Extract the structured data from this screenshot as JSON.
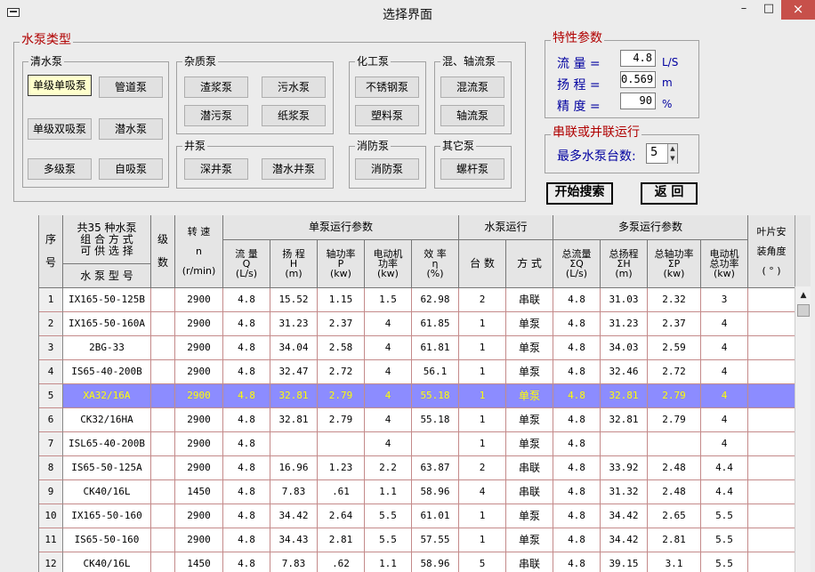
{
  "window": {
    "title": "选择界面",
    "min": "–",
    "max": "□",
    "close": "×"
  },
  "pump_types": {
    "title": "水泵类型",
    "clear_water": {
      "title": "清水泵",
      "buttons": [
        "单级单吸泵",
        "管道泵",
        "单级双吸泵",
        "潜水泵",
        "多级泵",
        "自吸泵"
      ]
    },
    "impurity": {
      "title": "杂质泵",
      "buttons": [
        "渣浆泵",
        "污水泵",
        "潜污泵",
        "纸浆泵"
      ]
    },
    "chemical": {
      "title": "化工泵",
      "buttons": [
        "不锈钢泵",
        "塑料泵"
      ]
    },
    "mixed_flow": {
      "title": "混、轴流泵",
      "buttons": [
        "混流泵",
        "轴流泵"
      ]
    },
    "well": {
      "title": "井泵",
      "buttons": [
        "深井泵",
        "潜水井泵"
      ]
    },
    "fire": {
      "title": "消防泵",
      "buttons": [
        "消防泵"
      ]
    },
    "other": {
      "title": "其它泵",
      "buttons": [
        "螺杆泵"
      ]
    }
  },
  "params": {
    "title": "特性参数",
    "flow_label": "流  量 =",
    "flow_value": "4.8",
    "flow_unit": "L/S",
    "head_label": "扬  程 =",
    "head_value": "0.569",
    "head_unit": "m",
    "precision_label": "精  度 =",
    "precision_value": "90",
    "precision_unit": "%"
  },
  "operation": {
    "title": "串联或并联运行",
    "max_pumps_label": "最多水泵台数:",
    "max_pumps_value": "5"
  },
  "actions": {
    "search": "开始搜索",
    "back": "返  回"
  },
  "grid": {
    "headers": {
      "seq": "序\n\n号",
      "model_top": "共35 种水泵\n组 合 方 式\n可 供 选 择",
      "model_bottom": "水 泵 型 号",
      "stages": "级\n\n数",
      "speed": "转  速\n\nn\n\n(r/min)",
      "single_group": "单泵运行参数",
      "flow": "流  量\nQ\n(L/s)",
      "head": "扬  程\nH\n(m)",
      "shaft_power": "轴功率\nP\n(kw)",
      "motor_power": "电动机\n功率\n(kw)",
      "efficiency": "效  率\nη\n(%)",
      "run_group": "水泵运行",
      "count": "台  数",
      "mode": "方  式",
      "multi_group": "多泵运行参数",
      "total_flow": "总流量\nΣQ\n(L/s)",
      "total_head": "总扬程\nΣH\n(m)",
      "total_shaft": "总轴功率\nΣP\n(kw)",
      "total_motor": "电动机\n总功率\n(kw)",
      "blade_angle": "叶片安\n\n装角度\n\n( ° )"
    },
    "rows": [
      [
        "1",
        "IX165-50-125B",
        "",
        "2900",
        "4.8",
        "15.52",
        "1.15",
        "1.5",
        "62.98",
        "2",
        "串联",
        "4.8",
        "31.03",
        "2.32",
        "3",
        ""
      ],
      [
        "2",
        "IX165-50-160A",
        "",
        "2900",
        "4.8",
        "31.23",
        "2.37",
        "4",
        "61.85",
        "1",
        "单泵",
        "4.8",
        "31.23",
        "2.37",
        "4",
        ""
      ],
      [
        "3",
        "2BG-33",
        "",
        "2900",
        "4.8",
        "34.04",
        "2.58",
        "4",
        "61.81",
        "1",
        "单泵",
        "4.8",
        "34.03",
        "2.59",
        "4",
        ""
      ],
      [
        "4",
        "IS65-40-200B",
        "",
        "2900",
        "4.8",
        "32.47",
        "2.72",
        "4",
        "56.1",
        "1",
        "单泵",
        "4.8",
        "32.46",
        "2.72",
        "4",
        ""
      ],
      [
        "5",
        "XA32/16A",
        "",
        "2900",
        "4.8",
        "32.81",
        "2.79",
        "4",
        "55.18",
        "1",
        "单泵",
        "4.8",
        "32.81",
        "2.79",
        "4",
        ""
      ],
      [
        "6",
        "CK32/16HA",
        "",
        "2900",
        "4.8",
        "32.81",
        "2.79",
        "4",
        "55.18",
        "1",
        "单泵",
        "4.8",
        "32.81",
        "2.79",
        "4",
        ""
      ],
      [
        "7",
        "ISL65-40-200B",
        "",
        "2900",
        "4.8",
        "",
        "",
        "4",
        "",
        "1",
        "单泵",
        "4.8",
        "",
        "",
        "4",
        ""
      ],
      [
        "8",
        "IS65-50-125A",
        "",
        "2900",
        "4.8",
        "16.96",
        "1.23",
        "2.2",
        "63.87",
        "2",
        "串联",
        "4.8",
        "33.92",
        "2.48",
        "4.4",
        ""
      ],
      [
        "9",
        "CK40/16L",
        "",
        "1450",
        "4.8",
        "7.83",
        ".61",
        "1.1",
        "58.96",
        "4",
        "串联",
        "4.8",
        "31.32",
        "2.48",
        "4.4",
        ""
      ],
      [
        "10",
        "IX165-50-160",
        "",
        "2900",
        "4.8",
        "34.42",
        "2.64",
        "5.5",
        "61.01",
        "1",
        "单泵",
        "4.8",
        "34.42",
        "2.65",
        "5.5",
        ""
      ],
      [
        "11",
        "IS65-50-160",
        "",
        "2900",
        "4.8",
        "34.43",
        "2.81",
        "5.5",
        "57.55",
        "1",
        "单泵",
        "4.8",
        "34.42",
        "2.81",
        "5.5",
        ""
      ],
      [
        "12",
        "CK40/16L",
        "",
        "1450",
        "4.8",
        "7.83",
        ".62",
        "1.1",
        "58.96",
        "5",
        "串联",
        "4.8",
        "39.15",
        "3.1",
        "5.5",
        ""
      ]
    ],
    "selected_row": 5
  }
}
